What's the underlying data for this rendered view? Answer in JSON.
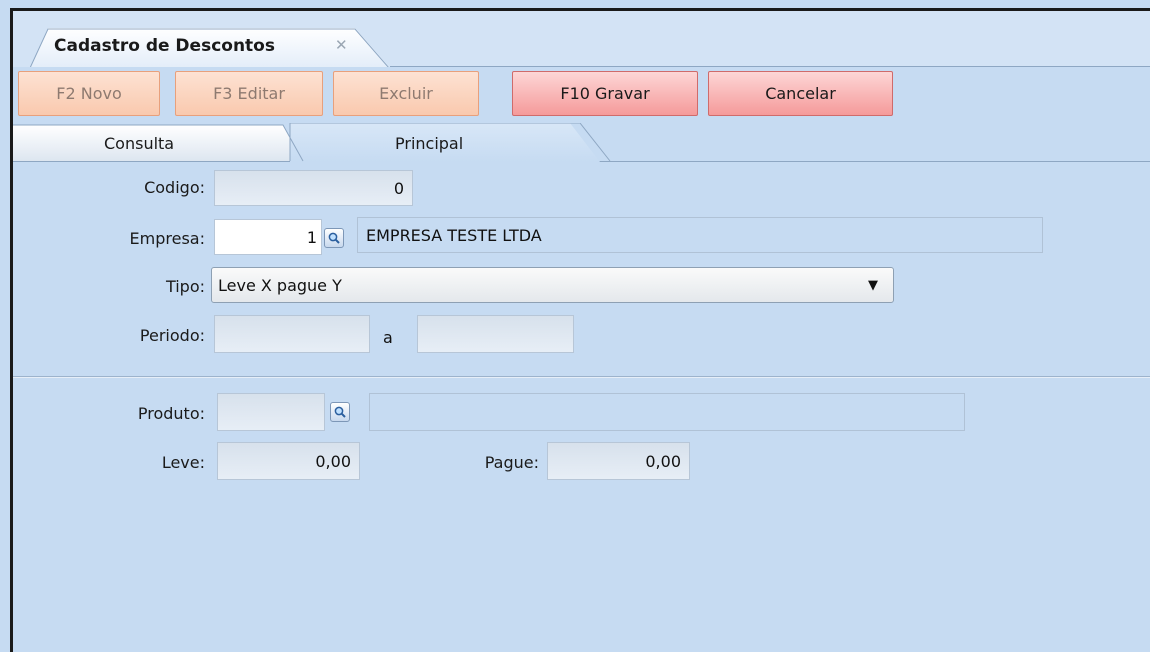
{
  "window": {
    "tab_title": "Cadastro de Descontos",
    "tab_close": "✕"
  },
  "toolbar": {
    "novo": "F2 Novo",
    "editar": "F3 Editar",
    "excluir": "Excluir",
    "gravar": "F10 Gravar",
    "cancelar": "Cancelar"
  },
  "tabs": {
    "consulta": "Consulta",
    "principal": "Principal"
  },
  "form": {
    "codigo_label": "Codigo:",
    "codigo_value": "0",
    "empresa_label": "Empresa:",
    "empresa_code": "1",
    "empresa_name": "EMPRESA TESTE LTDA",
    "tipo_label": "Tipo:",
    "tipo_value": "Leve X pague Y",
    "periodo_label": "Periodo:",
    "periodo_from": "",
    "periodo_sep": "a",
    "periodo_to": "",
    "produto_label": "Produto:",
    "produto_code": "",
    "produto_name": "",
    "leve_label": "Leve:",
    "leve_value": "0,00",
    "pague_label": "Pague:",
    "pague_value": "0,00"
  },
  "icons": {
    "lookup": "magnifier-icon",
    "dropdown": "chevron-down-icon"
  }
}
